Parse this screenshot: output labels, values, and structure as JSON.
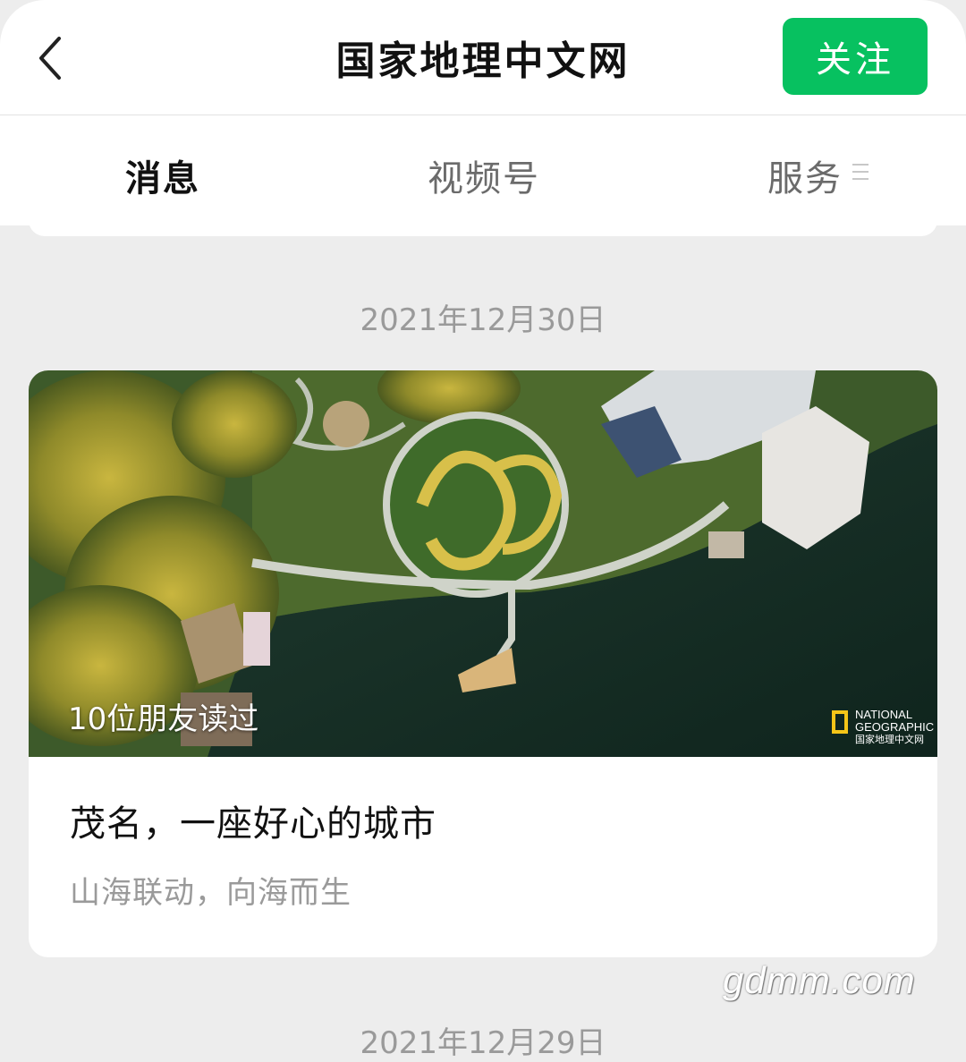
{
  "header": {
    "title": "国家地理中文网",
    "follow_label": "关注",
    "back_icon": "chevron-left-icon"
  },
  "tabs": [
    {
      "label": "消息",
      "active": true
    },
    {
      "label": "视频号",
      "active": false
    },
    {
      "label": "服务",
      "active": false
    }
  ],
  "feed": {
    "date": "2021年12月30日",
    "article": {
      "readers": "10位朋友读过",
      "title": "茂名，一座好心的城市",
      "subtitle": "山海联动，向海而生",
      "logo_lines": [
        "NATIONAL",
        "GEOGRAPHIC",
        "国家地理中文网"
      ]
    },
    "next_date": "2021年12月29日"
  },
  "watermark": "gdmm.com",
  "colors": {
    "accent": "#07c160",
    "background": "#ededed",
    "logo_yellow": "#f5c518"
  }
}
